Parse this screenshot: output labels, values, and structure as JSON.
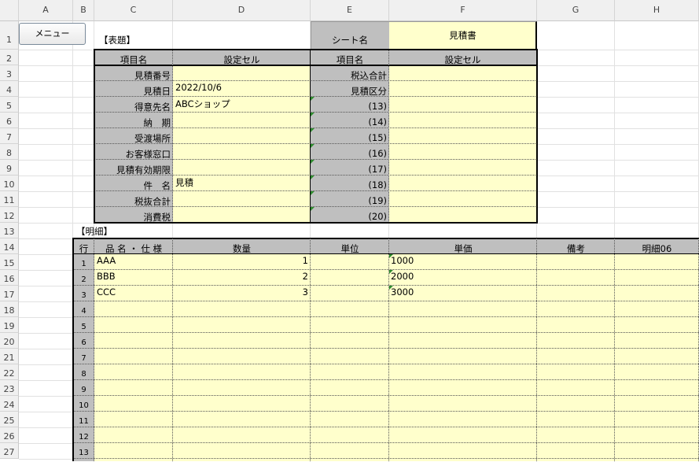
{
  "columns": [
    "A",
    "B",
    "C",
    "D",
    "E",
    "F",
    "G",
    "H"
  ],
  "rows": [
    "1",
    "2",
    "3",
    "4",
    "5",
    "6",
    "7",
    "8",
    "9",
    "10",
    "11",
    "12",
    "13",
    "14",
    "15",
    "16",
    "17",
    "18",
    "19",
    "20",
    "21",
    "22",
    "23",
    "24",
    "25",
    "26",
    "27"
  ],
  "menu_button": "メニュー",
  "header_section": {
    "title": "【表題】",
    "sheet_name_label": "シート名",
    "sheet_name_value": "見積書",
    "col_item": "項目名",
    "col_setting": "設定セル",
    "left_items": [
      "見積番号",
      "見積日",
      "得意先名",
      "納　期",
      "受渡場所",
      "お客様窓口",
      "見積有効期限",
      "件　名",
      "税抜合計",
      "消費税"
    ],
    "left_values": [
      "",
      "2022/10/6",
      "ABCショップ",
      "",
      "",
      "",
      "",
      "見積",
      "",
      ""
    ],
    "right_items": [
      "税込合計",
      "見積区分",
      "(13)",
      "(14)",
      "(15)",
      "(16)",
      "(17)",
      "(18)",
      "(19)",
      "(20)"
    ],
    "right_values": [
      "",
      "",
      "",
      "",
      "",
      "",
      "",
      "",
      "",
      ""
    ]
  },
  "detail_section": {
    "title": "【明細】",
    "headers": [
      "行",
      "品 名 ・ 仕 様",
      "数量",
      "単位",
      "単価",
      "備考",
      "明細06"
    ],
    "row_numbers": [
      "1",
      "2",
      "3",
      "4",
      "5",
      "6",
      "7",
      "8",
      "9",
      "10",
      "11",
      "12",
      "13"
    ],
    "items": [
      {
        "name": "AAA",
        "qty": "1",
        "unit": "",
        "price": "1000"
      },
      {
        "name": "BBB",
        "qty": "2",
        "unit": "",
        "price": "2000"
      },
      {
        "name": "CCC",
        "qty": "3",
        "unit": "",
        "price": "3000"
      }
    ]
  }
}
